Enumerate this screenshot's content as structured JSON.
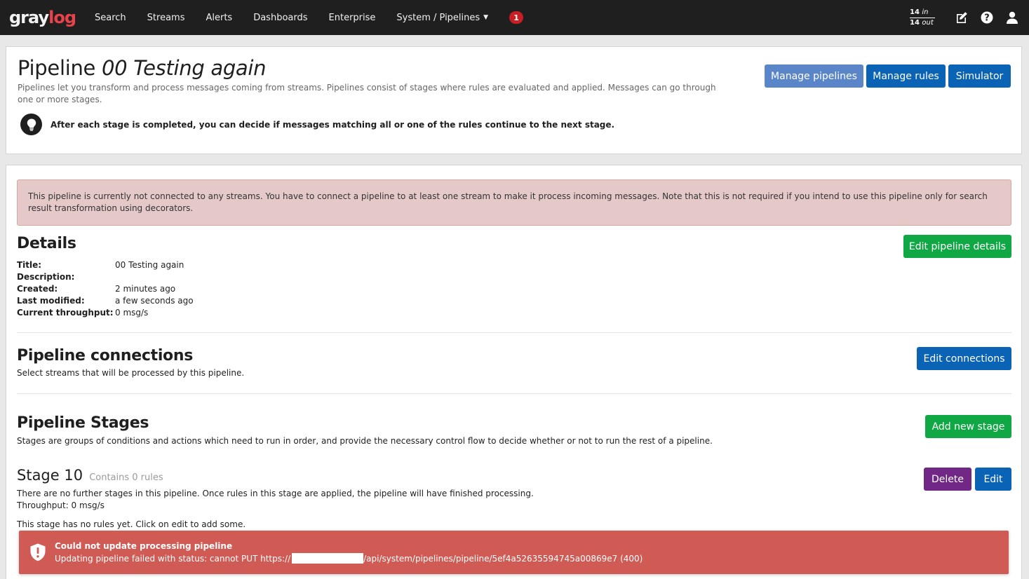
{
  "nav": {
    "logo_gray": "gray",
    "logo_log": "log",
    "items": [
      {
        "label": "Search"
      },
      {
        "label": "Streams"
      },
      {
        "label": "Alerts"
      },
      {
        "label": "Dashboards"
      },
      {
        "label": "Enterprise"
      },
      {
        "label": "System / Pipelines"
      }
    ],
    "notification_count": "1",
    "throughput": {
      "in_count": "14",
      "in_label": "in",
      "out_count": "14",
      "out_label": "out"
    },
    "icons": [
      "edit-icon",
      "help-icon",
      "user-icon"
    ]
  },
  "header": {
    "title_prefix": "Pipeline",
    "title_name": "00 Testing again",
    "description": "Pipelines let you transform and process messages coming from streams. Pipelines consist of stages where rules are evaluated and applied. Messages can go through one or more stages.",
    "tip": "After each stage is completed, you can decide if messages matching all or one of the rules continue to the next stage.",
    "buttons": {
      "manage_pipelines": "Manage pipelines",
      "manage_rules": "Manage rules",
      "simulator": "Simulator"
    }
  },
  "warning": "This pipeline is currently not connected to any streams. You have to connect a pipeline to at least one stream to make it process incoming messages. Note that this is not required if you intend to use this pipeline only for search result transformation using decorators.",
  "details": {
    "heading": "Details",
    "edit_button": "Edit pipeline details",
    "rows": [
      {
        "label": "Title:",
        "value": "00 Testing again"
      },
      {
        "label": "Description:",
        "value": ""
      },
      {
        "label": "Created:",
        "value": "2 minutes ago"
      },
      {
        "label": "Last modified:",
        "value": "a few seconds ago"
      },
      {
        "label": "Current throughput:",
        "value": "0 msg/s"
      }
    ]
  },
  "connections": {
    "heading": "Pipeline connections",
    "description": "Select streams that will be processed by this pipeline.",
    "edit_button": "Edit connections"
  },
  "stages": {
    "heading": "Pipeline Stages",
    "description": "Stages are groups of conditions and actions which need to run in order, and provide the necessary control flow to decide whether or not to run the rest of a pipeline.",
    "add_button": "Add new stage",
    "stage": {
      "title": "Stage 10",
      "rule_count": "Contains 0 rules",
      "info": "There are no further stages in this pipeline. Once rules in this stage are applied, the pipeline will have finished processing.",
      "throughput": "Throughput: 0 msg/s",
      "empty": "This stage has no rules yet. Click on edit to add some.",
      "delete_button": "Delete",
      "edit_button": "Edit"
    }
  },
  "toast": {
    "title": "Could not update processing pipeline",
    "message_prefix": "Updating pipeline failed with status: cannot PUT https://",
    "message_suffix": "/api/system/pipelines/pipeline/5ef4a52635594745a00869e7 (400)"
  },
  "colors": {
    "nav_bg": "#1f1f1f",
    "primary": "#0b63b5",
    "success": "#0fa844",
    "danger": "#702785",
    "toast_bg": "#d05b55",
    "warning_bg": "#e5c9c9"
  }
}
